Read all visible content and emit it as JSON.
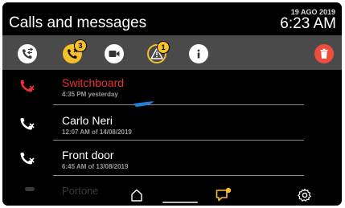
{
  "header": {
    "title": "Calls and messages",
    "date": "19 AGO 2019",
    "time": "6:23 AM"
  },
  "toolbar": {
    "buttons": [
      {
        "icon": "call-history-icon",
        "style": "white"
      },
      {
        "icon": "missed-call-icon",
        "style": "yellow",
        "badge": "3"
      },
      {
        "icon": "video-icon",
        "style": "white"
      },
      {
        "icon": "alarm-icon",
        "style": "outline",
        "badge": "1"
      },
      {
        "icon": "info-icon",
        "style": "white"
      },
      {
        "icon": "trash-icon",
        "style": "red"
      }
    ]
  },
  "calls": [
    {
      "name": "Switchboard",
      "subtitle": "4:35 PM yesterday",
      "icon": "missed-call-icon",
      "highlight": true
    },
    {
      "name": "Carlo Neri",
      "subtitle": "12:07 AM of 14/08/2019",
      "icon": "missed-call-icon",
      "highlight": false
    },
    {
      "name": "Front door",
      "subtitle": "6:45 AM of 13/08/2019",
      "icon": "missed-call-icon",
      "highlight": false
    },
    {
      "name": "Portone",
      "subtitle": "",
      "icon": "missed-call-icon",
      "highlight": false
    }
  ],
  "nav": {
    "home_icon": "home-icon",
    "messages_icon": "messages-icon",
    "settings_icon": "settings-icon"
  },
  "colors": {
    "accent_yellow": "#f5c02b",
    "alert_red": "#ef4c3c",
    "highlight_red": "#e8312f",
    "toolbar_bg": "#4a4a4a",
    "screen_bg": "#000000",
    "scroll_indicator": "#1e7fd6"
  }
}
